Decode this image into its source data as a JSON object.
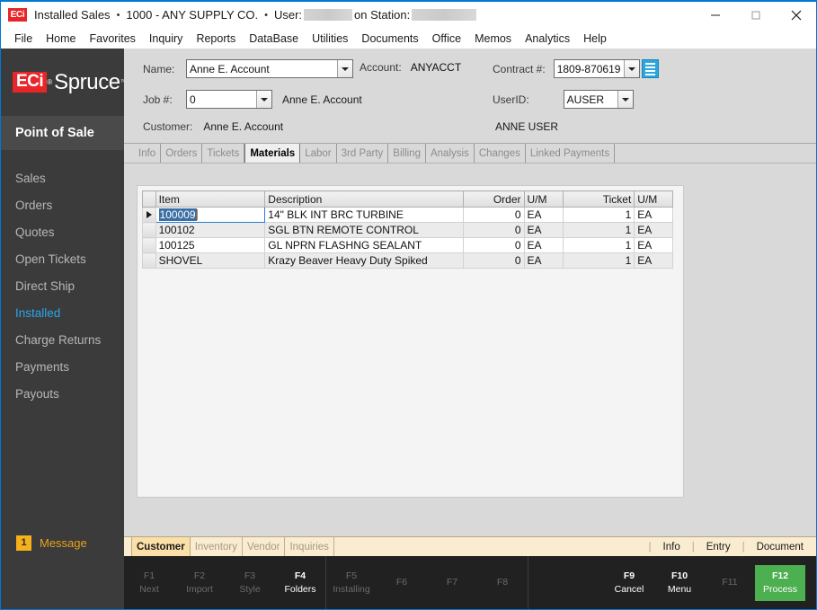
{
  "window": {
    "logo_text": "ECi",
    "title_app": "Installed Sales",
    "title_company": "1000 - ANY SUPPLY CO.",
    "title_user_label": "User:",
    "title_station_label": "on Station:",
    "dot": "•",
    "minimize_icon": "minimize-icon",
    "maximize_icon": "maximize-icon",
    "close_icon": "close-icon"
  },
  "menubar": {
    "items": [
      {
        "label": "File"
      },
      {
        "label": "Home"
      },
      {
        "label": "Favorites"
      },
      {
        "label": "Inquiry"
      },
      {
        "label": "Reports"
      },
      {
        "label": "DataBase"
      },
      {
        "label": "Utilities"
      },
      {
        "label": "Documents"
      },
      {
        "label": "Office"
      },
      {
        "label": "Memos"
      },
      {
        "label": "Analytics"
      },
      {
        "label": "Help"
      }
    ]
  },
  "sidebar": {
    "brand_eci": "ECi",
    "brand_name": "Spruce",
    "section_title": "Point of Sale",
    "items": [
      {
        "label": "Sales",
        "active": false
      },
      {
        "label": "Orders",
        "active": false
      },
      {
        "label": "Quotes",
        "active": false
      },
      {
        "label": "Open Tickets",
        "active": false
      },
      {
        "label": "Direct Ship",
        "active": false
      },
      {
        "label": "Installed",
        "active": true
      },
      {
        "label": "Charge Returns",
        "active": false
      },
      {
        "label": "Payments",
        "active": false
      },
      {
        "label": "Payouts",
        "active": false
      }
    ],
    "message_count": "1",
    "message_label": "Message",
    "accent_active": "#2aa6e8",
    "accent_message": "#e8a21b"
  },
  "form": {
    "name_label": "Name:",
    "name_value": "Anne E. Account",
    "account_label": "Account:",
    "account_value": "ANYACCT",
    "contract_label": "Contract #:",
    "contract_value": "1809-870619",
    "contract_list_icon": "list-icon",
    "job_label": "Job #:",
    "job_value": "0",
    "job_name": "Anne E. Account",
    "userid_label": "UserID:",
    "userid_value": "AUSER",
    "user_fullname": "ANNE USER",
    "customer_label": "Customer:",
    "customer_value": "Anne E. Account"
  },
  "tabs": {
    "items": [
      {
        "label": "Info",
        "active": false
      },
      {
        "label": "Orders",
        "active": false
      },
      {
        "label": "Tickets",
        "active": false
      },
      {
        "label": "Materials",
        "active": true
      },
      {
        "label": "Labor",
        "active": false
      },
      {
        "label": "3rd Party",
        "active": false
      },
      {
        "label": "Billing",
        "active": false
      },
      {
        "label": "Analysis",
        "active": false
      },
      {
        "label": "Changes",
        "active": false
      },
      {
        "label": "Linked Payments",
        "active": false
      }
    ]
  },
  "grid": {
    "columns": [
      {
        "label": "Item",
        "align": "left"
      },
      {
        "label": "Description",
        "align": "left"
      },
      {
        "label": "Order",
        "align": "right"
      },
      {
        "label": "U/M",
        "align": "left"
      },
      {
        "label": "Ticket",
        "align": "right"
      },
      {
        "label": "U/M",
        "align": "left"
      }
    ],
    "rows": [
      {
        "selected": true,
        "item": "100009",
        "description": "14\" BLK INT BRC TURBINE",
        "order": "0",
        "order_um": "EA",
        "ticket": "1",
        "ticket_um": "EA"
      },
      {
        "selected": false,
        "item": "100102",
        "description": "SGL BTN REMOTE CONTROL",
        "order": "0",
        "order_um": "EA",
        "ticket": "1",
        "ticket_um": "EA"
      },
      {
        "selected": false,
        "item": "100125",
        "description": "GL NPRN FLASHNG SEALANT",
        "order": "0",
        "order_um": "EA",
        "ticket": "1",
        "ticket_um": "EA"
      },
      {
        "selected": false,
        "item": "SHOVEL",
        "description": "Krazy Beaver Heavy Duty Spiked",
        "order": "0",
        "order_um": "EA",
        "ticket": "1",
        "ticket_um": "EA"
      }
    ]
  },
  "actionbar": {
    "tabs": [
      {
        "label": "Customer",
        "active": true
      },
      {
        "label": "Inventory",
        "active": false
      },
      {
        "label": "Vendor",
        "active": false
      },
      {
        "label": "Inquiries",
        "active": false
      }
    ],
    "links": [
      {
        "label": "Info"
      },
      {
        "label": "Entry"
      },
      {
        "label": "Document"
      }
    ],
    "separator": "|"
  },
  "fnbar": {
    "group1": [
      {
        "key": "F1",
        "label": "Next",
        "enabled": false
      },
      {
        "key": "F2",
        "label": "Import",
        "enabled": false
      },
      {
        "key": "F3",
        "label": "Style",
        "enabled": false
      },
      {
        "key": "F4",
        "label": "Folders",
        "enabled": true
      }
    ],
    "group2": [
      {
        "key": "F5",
        "label": "Installing",
        "enabled": false
      },
      {
        "key": "F6",
        "label": "",
        "enabled": false
      },
      {
        "key": "F7",
        "label": "",
        "enabled": false
      },
      {
        "key": "F8",
        "label": "",
        "enabled": false
      }
    ],
    "group3": [
      {
        "key": "F9",
        "label": "Cancel",
        "enabled": true
      },
      {
        "key": "F10",
        "label": "Menu",
        "enabled": true
      },
      {
        "key": "F11",
        "label": "",
        "enabled": false
      }
    ],
    "process": {
      "key": "F12",
      "label": "Process",
      "color": "#4caf50"
    }
  }
}
